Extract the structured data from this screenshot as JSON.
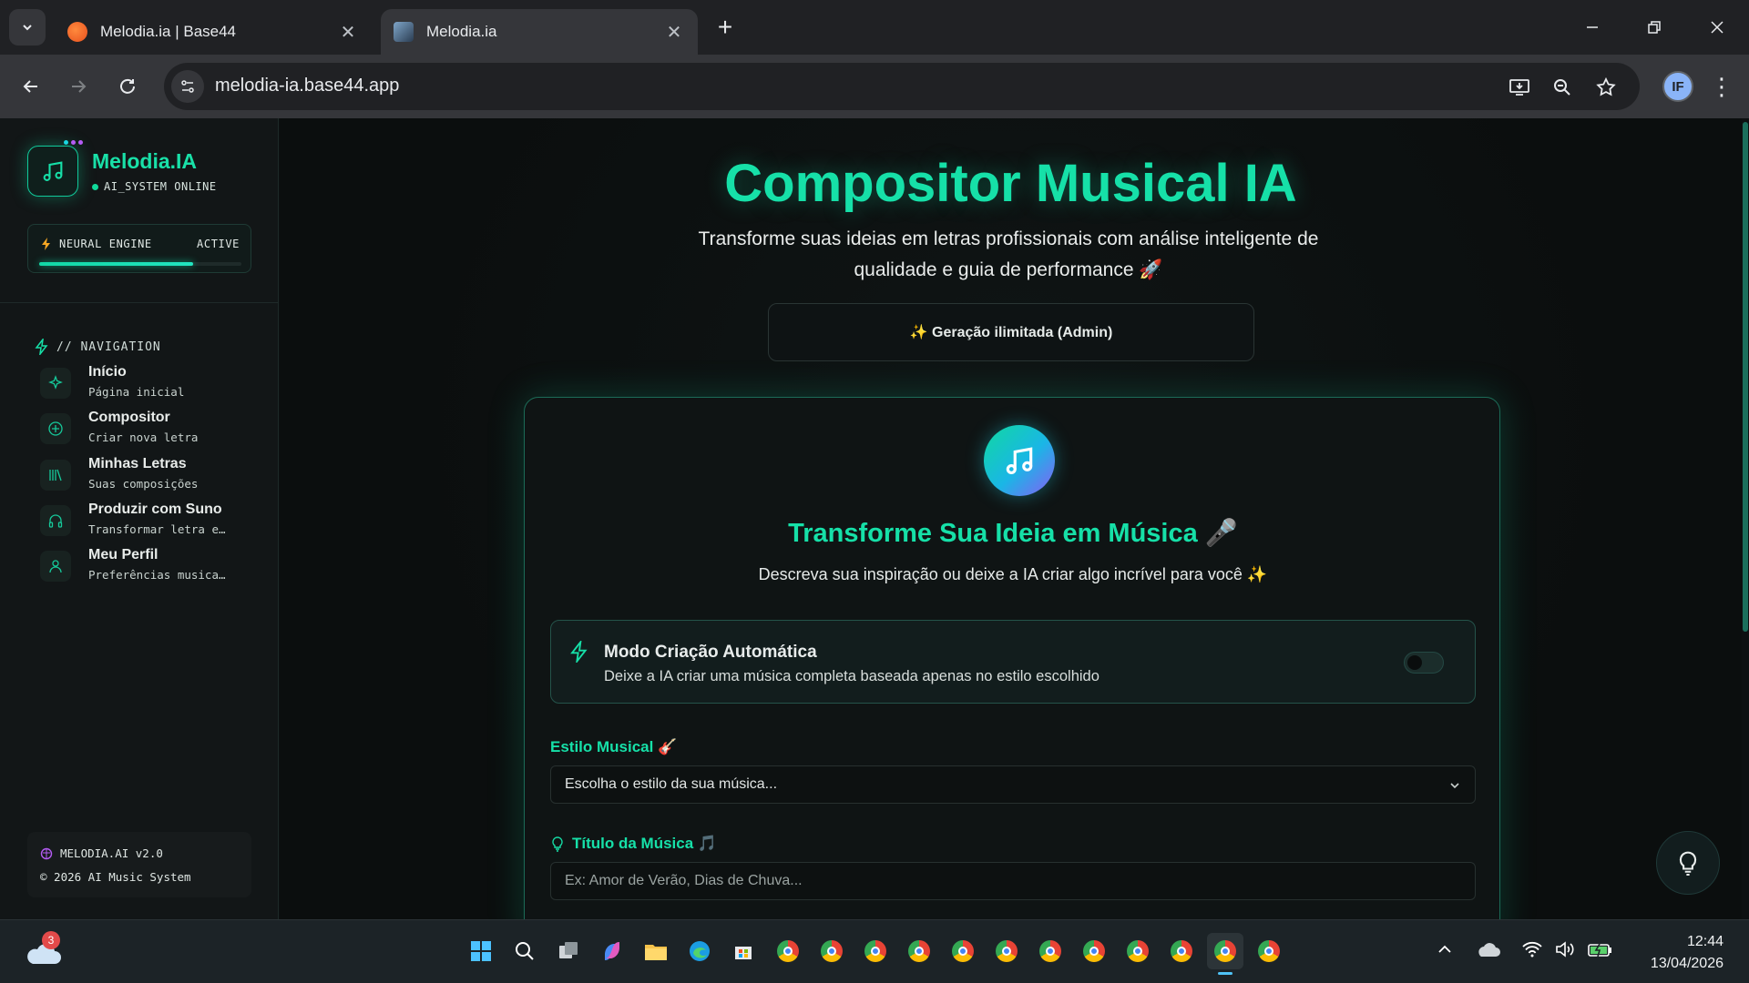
{
  "browser": {
    "tabs": [
      {
        "title": "Melodia.ia | Base44",
        "active": false
      },
      {
        "title": "Melodia.ia",
        "active": true
      }
    ],
    "url": "melodia-ia.base44.app"
  },
  "sidebar": {
    "brand": "Melodia.IA",
    "status": "AI_SYSTEM ONLINE",
    "engine_label": "NEURAL ENGINE",
    "engine_status": "ACTIVE",
    "engine_level": 0.76,
    "nav_heading": "// NAVIGATION",
    "items": [
      {
        "label": "Início",
        "sub": "Página inicial",
        "icon": "sparkle-icon"
      },
      {
        "label": "Compositor",
        "sub": "Criar nova letra",
        "icon": "plus-circle-icon"
      },
      {
        "label": "Minhas Letras",
        "sub": "Suas composições",
        "icon": "library-icon"
      },
      {
        "label": "Produzir com Suno",
        "sub": "Transformar letra e…",
        "icon": "headphones-icon"
      },
      {
        "label": "Meu Perfil",
        "sub": "Preferências musica…",
        "icon": "user-icon"
      }
    ],
    "version": "MELODIA.AI v2.0",
    "copyright": "© 2026 AI Music System"
  },
  "main": {
    "title": "Compositor Musical IA",
    "subtitle": "Transforme suas ideias em letras profissionais com análise inteligente de qualidade e guia de performance 🚀",
    "unlimited": "✨ Geração ilimitada (Admin)",
    "card": {
      "title": "Transforme Sua Ideia em Música 🎤",
      "subtitle": "Descreva sua inspiração ou deixe a IA criar algo incrível para você ✨",
      "auto_mode_title": "Modo Criação Automática",
      "auto_mode_desc": "Deixe a IA criar uma música completa baseada apenas no estilo escolhido",
      "style_label": "Estilo Musical 🎸",
      "style_value": "Escolha o estilo da sua música...",
      "title_label": "Título da Música 🎵",
      "title_placeholder": "Ex: Amor de Verão, Dias de Chuva..."
    }
  },
  "taskbar": {
    "weather_badge": "3",
    "time": "12:44",
    "date": "13/04/2026"
  },
  "colors": {
    "accent": "#16e0a8",
    "background": "#0d1011",
    "sidebar": "#121617"
  }
}
